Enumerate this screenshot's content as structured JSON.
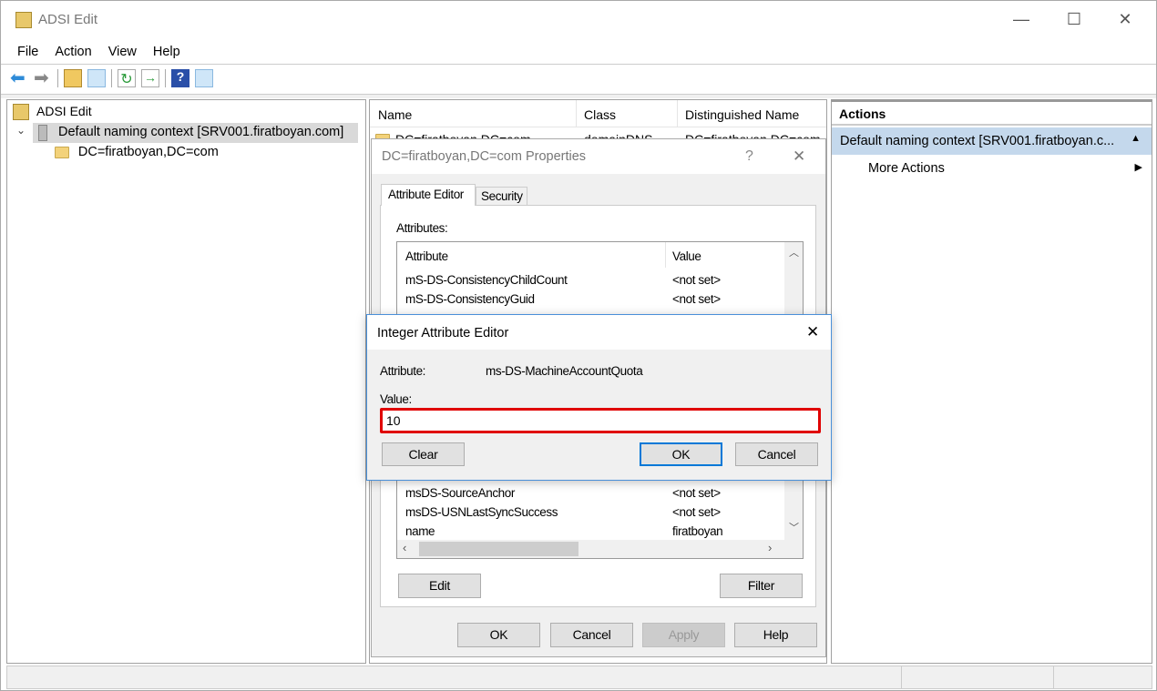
{
  "window": {
    "title": "ADSI Edit",
    "minimize": "—",
    "maximize": "☐",
    "close": "✕"
  },
  "menu": [
    "File",
    "Action",
    "View",
    "Help"
  ],
  "toolbar": {
    "icons": [
      "back-arrow-icon",
      "forward-arrow-icon",
      "up-folder-icon",
      "show-hide-tree-icon",
      "refresh-icon",
      "export-list-icon",
      "help-icon",
      "show-hide-action-pane-icon"
    ]
  },
  "tree": {
    "root": "ADSI Edit",
    "context": "Default naming context [SRV001.firatboyan.com]",
    "child": "DC=firatboyan,DC=com"
  },
  "list": {
    "columns": [
      "Name",
      "Class",
      "Distinguished Name"
    ],
    "rows": [
      {
        "name": "DC=firatboyan,DC=com",
        "class": "domainDNS",
        "dn": "DC=firatboyan,DC=com"
      }
    ]
  },
  "actions": {
    "header": "Actions",
    "selected": "Default naming context [SRV001.firatboyan.c...",
    "more": "More Actions"
  },
  "properties": {
    "title": "DC=firatboyan,DC=com Properties",
    "help": "?",
    "close": "✕",
    "tabs": [
      "Attribute Editor",
      "Security"
    ],
    "attributes_label": "Attributes:",
    "columns": [
      "Attribute",
      "Value"
    ],
    "rows_top": [
      {
        "attr": "mS-DS-ConsistencyChildCount",
        "value": "<not set>"
      },
      {
        "attr": "mS-DS-ConsistencyGuid",
        "value": "<not set>"
      }
    ],
    "rows_bottom": [
      {
        "attr": "msDS-SourceAnchor",
        "value": "<not set>"
      },
      {
        "attr": "msDS-USNLastSyncSuccess",
        "value": "<not set>"
      },
      {
        "attr": "name",
        "value": "firatboyan"
      }
    ],
    "edit": "Edit",
    "filter": "Filter",
    "ok": "OK",
    "cancel": "Cancel",
    "apply": "Apply",
    "help_btn": "Help"
  },
  "integer_editor": {
    "title": "Integer Attribute Editor",
    "close": "✕",
    "attribute_label": "Attribute:",
    "attribute": "ms-DS-MachineAccountQuota",
    "value_label": "Value:",
    "value": "10",
    "clear": "Clear",
    "ok": "OK",
    "cancel": "Cancel",
    "highlight_color": "#e00000"
  }
}
